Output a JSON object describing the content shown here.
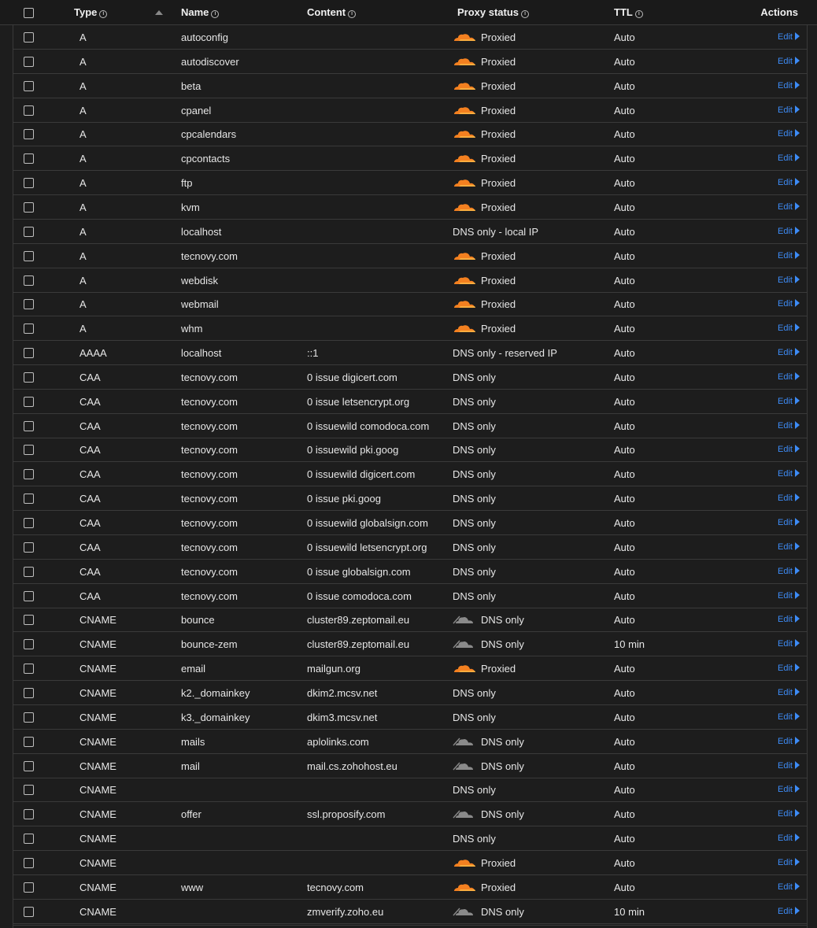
{
  "header": {
    "type_label": "Type",
    "name_label": "Name",
    "content_label": "Content",
    "proxy_label": "Proxy status",
    "ttl_label": "TTL",
    "actions_label": "Actions"
  },
  "edit_label": "Edit",
  "colors": {
    "accent": "#3d8bf5",
    "cloud_proxied": "#f38020",
    "cloud_dns": "#8a8a8a"
  },
  "rows": [
    {
      "type": "A",
      "name": "autoconfig",
      "content": "",
      "proxy": "Proxied",
      "icon": "orange-cloud-icon",
      "ttl": "Auto"
    },
    {
      "type": "A",
      "name": "autodiscover",
      "content": "",
      "proxy": "Proxied",
      "icon": "orange-cloud-icon",
      "ttl": "Auto"
    },
    {
      "type": "A",
      "name": "beta",
      "content": "",
      "proxy": "Proxied",
      "icon": "orange-cloud-icon",
      "ttl": "Auto"
    },
    {
      "type": "A",
      "name": "cpanel",
      "content": "",
      "proxy": "Proxied",
      "icon": "orange-cloud-icon",
      "ttl": "Auto"
    },
    {
      "type": "A",
      "name": "cpcalendars",
      "content": "",
      "proxy": "Proxied",
      "icon": "orange-cloud-icon",
      "ttl": "Auto"
    },
    {
      "type": "A",
      "name": "cpcontacts",
      "content": "",
      "proxy": "Proxied",
      "icon": "orange-cloud-icon",
      "ttl": "Auto"
    },
    {
      "type": "A",
      "name": "ftp",
      "content": "",
      "proxy": "Proxied",
      "icon": "orange-cloud-icon",
      "ttl": "Auto"
    },
    {
      "type": "A",
      "name": "kvm",
      "content": "",
      "proxy": "Proxied",
      "icon": "orange-cloud-icon",
      "ttl": "Auto"
    },
    {
      "type": "A",
      "name": "localhost",
      "content": "",
      "proxy": "DNS only - local IP",
      "icon": "",
      "ttl": "Auto"
    },
    {
      "type": "A",
      "name": "tecnovy.com",
      "content": "",
      "proxy": "Proxied",
      "icon": "orange-cloud-icon",
      "ttl": "Auto"
    },
    {
      "type": "A",
      "name": "webdisk",
      "content": "",
      "proxy": "Proxied",
      "icon": "orange-cloud-icon",
      "ttl": "Auto"
    },
    {
      "type": "A",
      "name": "webmail",
      "content": "",
      "proxy": "Proxied",
      "icon": "orange-cloud-icon",
      "ttl": "Auto"
    },
    {
      "type": "A",
      "name": "whm",
      "content": "",
      "proxy": "Proxied",
      "icon": "orange-cloud-icon",
      "ttl": "Auto"
    },
    {
      "type": "AAAA",
      "name": "localhost",
      "content": "::1",
      "proxy": "DNS only - reserved IP",
      "icon": "",
      "ttl": "Auto"
    },
    {
      "type": "CAA",
      "name": "tecnovy.com",
      "content": "0 issue digicert.com",
      "proxy": "DNS only",
      "icon": "",
      "ttl": "Auto"
    },
    {
      "type": "CAA",
      "name": "tecnovy.com",
      "content": "0 issue letsencrypt.org",
      "proxy": "DNS only",
      "icon": "",
      "ttl": "Auto"
    },
    {
      "type": "CAA",
      "name": "tecnovy.com",
      "content": "0 issuewild comodoca.com",
      "proxy": "DNS only",
      "icon": "",
      "ttl": "Auto"
    },
    {
      "type": "CAA",
      "name": "tecnovy.com",
      "content": "0 issuewild pki.goog",
      "proxy": "DNS only",
      "icon": "",
      "ttl": "Auto"
    },
    {
      "type": "CAA",
      "name": "tecnovy.com",
      "content": "0 issuewild digicert.com",
      "proxy": "DNS only",
      "icon": "",
      "ttl": "Auto"
    },
    {
      "type": "CAA",
      "name": "tecnovy.com",
      "content": "0 issue pki.goog",
      "proxy": "DNS only",
      "icon": "",
      "ttl": "Auto"
    },
    {
      "type": "CAA",
      "name": "tecnovy.com",
      "content": "0 issuewild globalsign.com",
      "proxy": "DNS only",
      "icon": "",
      "ttl": "Auto"
    },
    {
      "type": "CAA",
      "name": "tecnovy.com",
      "content": "0 issuewild letsencrypt.org",
      "proxy": "DNS only",
      "icon": "",
      "ttl": "Auto"
    },
    {
      "type": "CAA",
      "name": "tecnovy.com",
      "content": "0 issue globalsign.com",
      "proxy": "DNS only",
      "icon": "",
      "ttl": "Auto"
    },
    {
      "type": "CAA",
      "name": "tecnovy.com",
      "content": "0 issue comodoca.com",
      "proxy": "DNS only",
      "icon": "",
      "ttl": "Auto"
    },
    {
      "type": "CNAME",
      "name": "bounce",
      "content": "cluster89.zeptomail.eu",
      "proxy": "DNS only",
      "icon": "grey-cloud-icon",
      "ttl": "Auto"
    },
    {
      "type": "CNAME",
      "name": "bounce-zem",
      "content": "cluster89.zeptomail.eu",
      "proxy": "DNS only",
      "icon": "grey-cloud-icon",
      "ttl": "10 min"
    },
    {
      "type": "CNAME",
      "name": "email",
      "content": "mailgun.org",
      "proxy": "Proxied",
      "icon": "orange-cloud-icon",
      "ttl": "Auto"
    },
    {
      "type": "CNAME",
      "name": "k2._domainkey",
      "content": "dkim2.mcsv.net",
      "proxy": "DNS only",
      "icon": "",
      "ttl": "Auto"
    },
    {
      "type": "CNAME",
      "name": "k3._domainkey",
      "content": "dkim3.mcsv.net",
      "proxy": "DNS only",
      "icon": "",
      "ttl": "Auto"
    },
    {
      "type": "CNAME",
      "name": "mails",
      "content": "aplolinks.com",
      "proxy": "DNS only",
      "icon": "grey-cloud-icon",
      "ttl": "Auto"
    },
    {
      "type": "CNAME",
      "name": "mail",
      "content": "mail.cs.zohohost.eu",
      "proxy": "DNS only",
      "icon": "grey-cloud-icon",
      "ttl": "Auto"
    },
    {
      "type": "CNAME",
      "name": "",
      "content": "",
      "proxy": "DNS only",
      "icon": "",
      "ttl": "Auto"
    },
    {
      "type": "CNAME",
      "name": "offer",
      "content": "ssl.proposify.com",
      "proxy": "DNS only",
      "icon": "grey-cloud-icon",
      "ttl": "Auto"
    },
    {
      "type": "CNAME",
      "name": "",
      "content": "",
      "proxy": "DNS only",
      "icon": "",
      "ttl": "Auto"
    },
    {
      "type": "CNAME",
      "name": "",
      "content": "",
      "proxy": "Proxied",
      "icon": "orange-cloud-icon",
      "ttl": "Auto"
    },
    {
      "type": "CNAME",
      "name": "www",
      "content": "tecnovy.com",
      "proxy": "Proxied",
      "icon": "orange-cloud-icon",
      "ttl": "Auto"
    },
    {
      "type": "CNAME",
      "name": "",
      "content": "zmverify.zoho.eu",
      "proxy": "DNS only",
      "icon": "grey-cloud-icon",
      "ttl": "10 min"
    }
  ]
}
